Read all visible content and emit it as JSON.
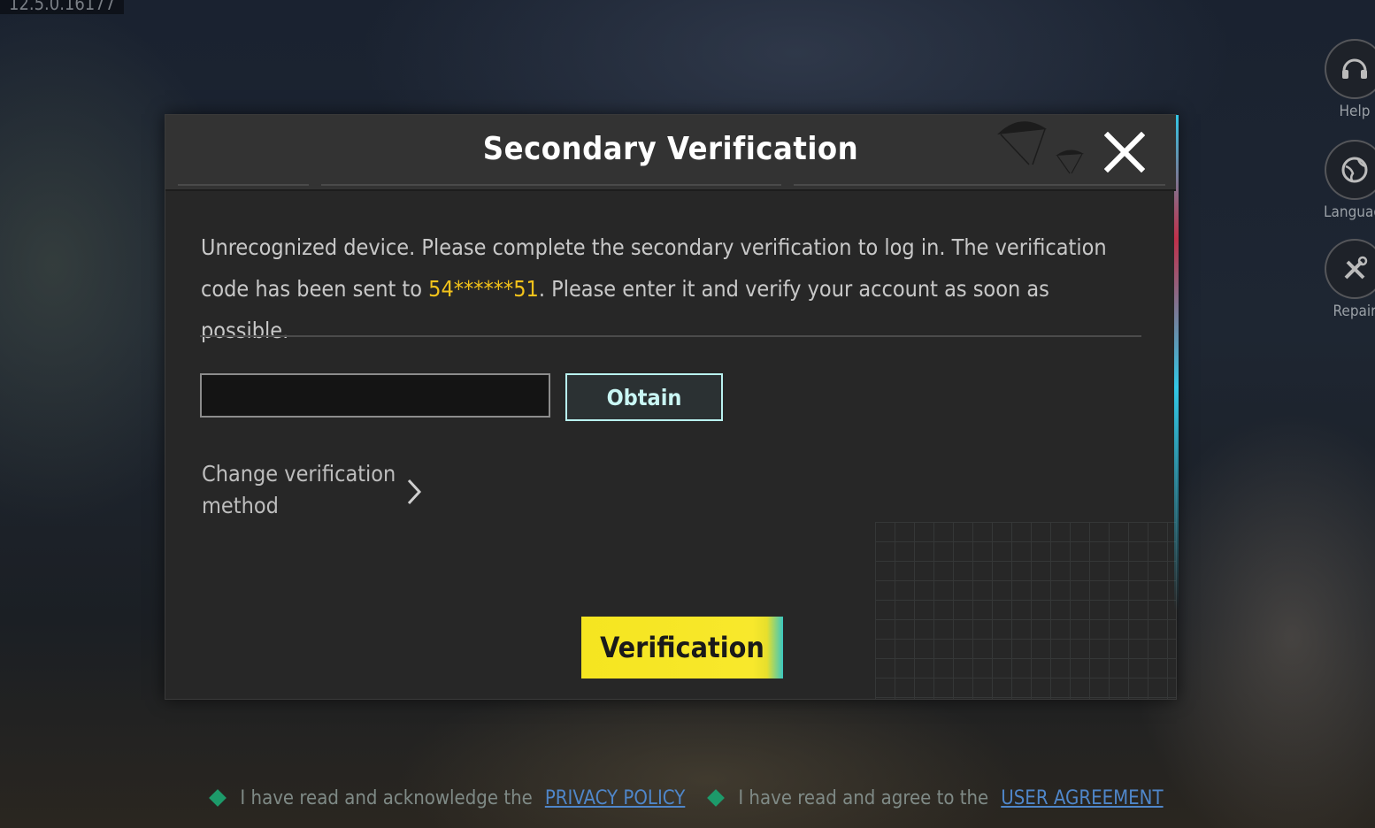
{
  "app": {
    "version": "12.5.0.16177"
  },
  "side_menu": [
    {
      "label": "Help",
      "icon": "headset-icon"
    },
    {
      "label": "Language",
      "icon": "globe-icon"
    },
    {
      "label": "Repair",
      "icon": "tools-icon"
    }
  ],
  "dialog": {
    "title": "Secondary Verification",
    "message_part1": "Unrecognized device. Please complete the secondary verification to log in. The verification code has been sent to ",
    "phone_masked": "54******51",
    "message_part2": ". Please enter it and verify your account as soon as possible.",
    "code_input": {
      "value": "",
      "placeholder": ""
    },
    "obtain_label": "Obtain",
    "change_method_label": "Change verification method",
    "verify_label": "Verification"
  },
  "footer": {
    "privacy_text": "I have read and acknowledge the",
    "privacy_link": "PRIVACY POLICY",
    "agreement_text": "I have read and agree to the",
    "agreement_link": "USER AGREEMENT"
  },
  "colors": {
    "accent_yellow": "#f5e520",
    "phone_highlight": "#f2c21b",
    "obtain_border": "#b9f2f0",
    "footer_link": "#4f86c9",
    "checkbox_green": "#1d9a6a"
  }
}
